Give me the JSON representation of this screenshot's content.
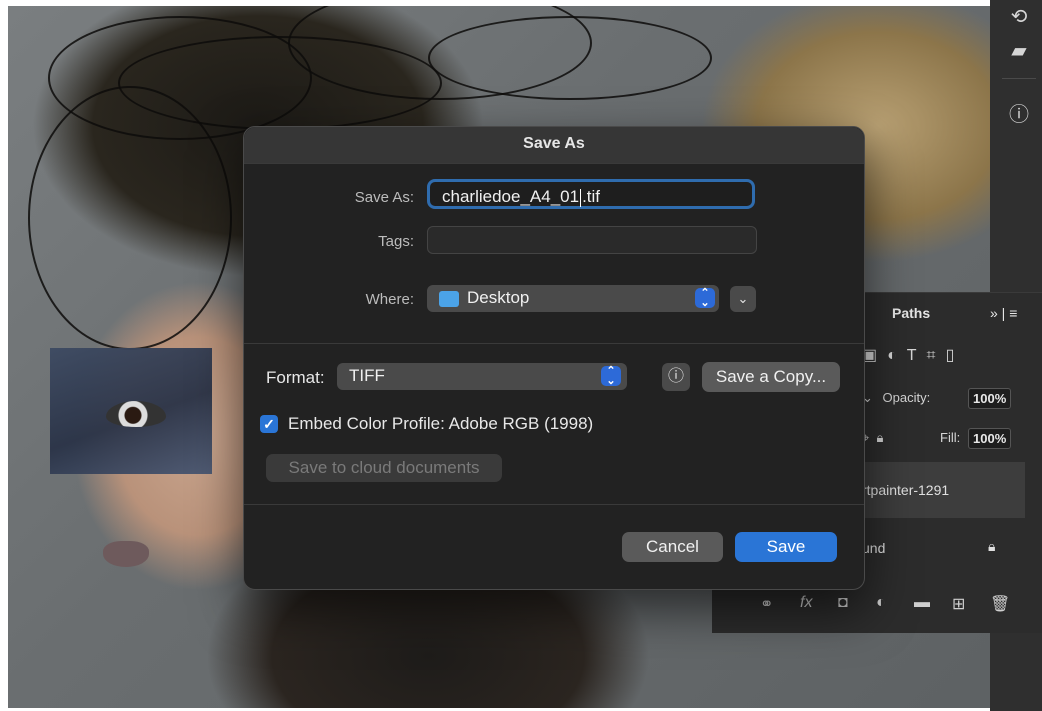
{
  "dialog": {
    "title": "Save As",
    "save_as_label": "Save As:",
    "filename_before_caret": "charliedoe_A4_01",
    "filename_after_caret": ".tif",
    "tags_label": "Tags:",
    "where_label": "Where:",
    "where_value": "Desktop",
    "format_label": "Format:",
    "format_value": "TIFF",
    "save_copy_label": "Save a Copy...",
    "embed_label": "Embed Color Profile:  Adobe RGB (1998)",
    "embed_checked": true,
    "cloud_label": "Save to cloud documents",
    "cancel_label": "Cancel",
    "save_label": "Save"
  },
  "panel": {
    "tab_label": "Paths",
    "more_label": "»",
    "opacity_label": "Opacity:",
    "opacity_value": "100%",
    "fill_label": "Fill:",
    "fill_value": "100%",
    "layer1_name": "rtpainter-1291",
    "layer2_name": "und"
  },
  "colors": {
    "accent": "#2a75d6",
    "focus_ring": "#2f6cae",
    "dialog_bg": "#222222"
  }
}
